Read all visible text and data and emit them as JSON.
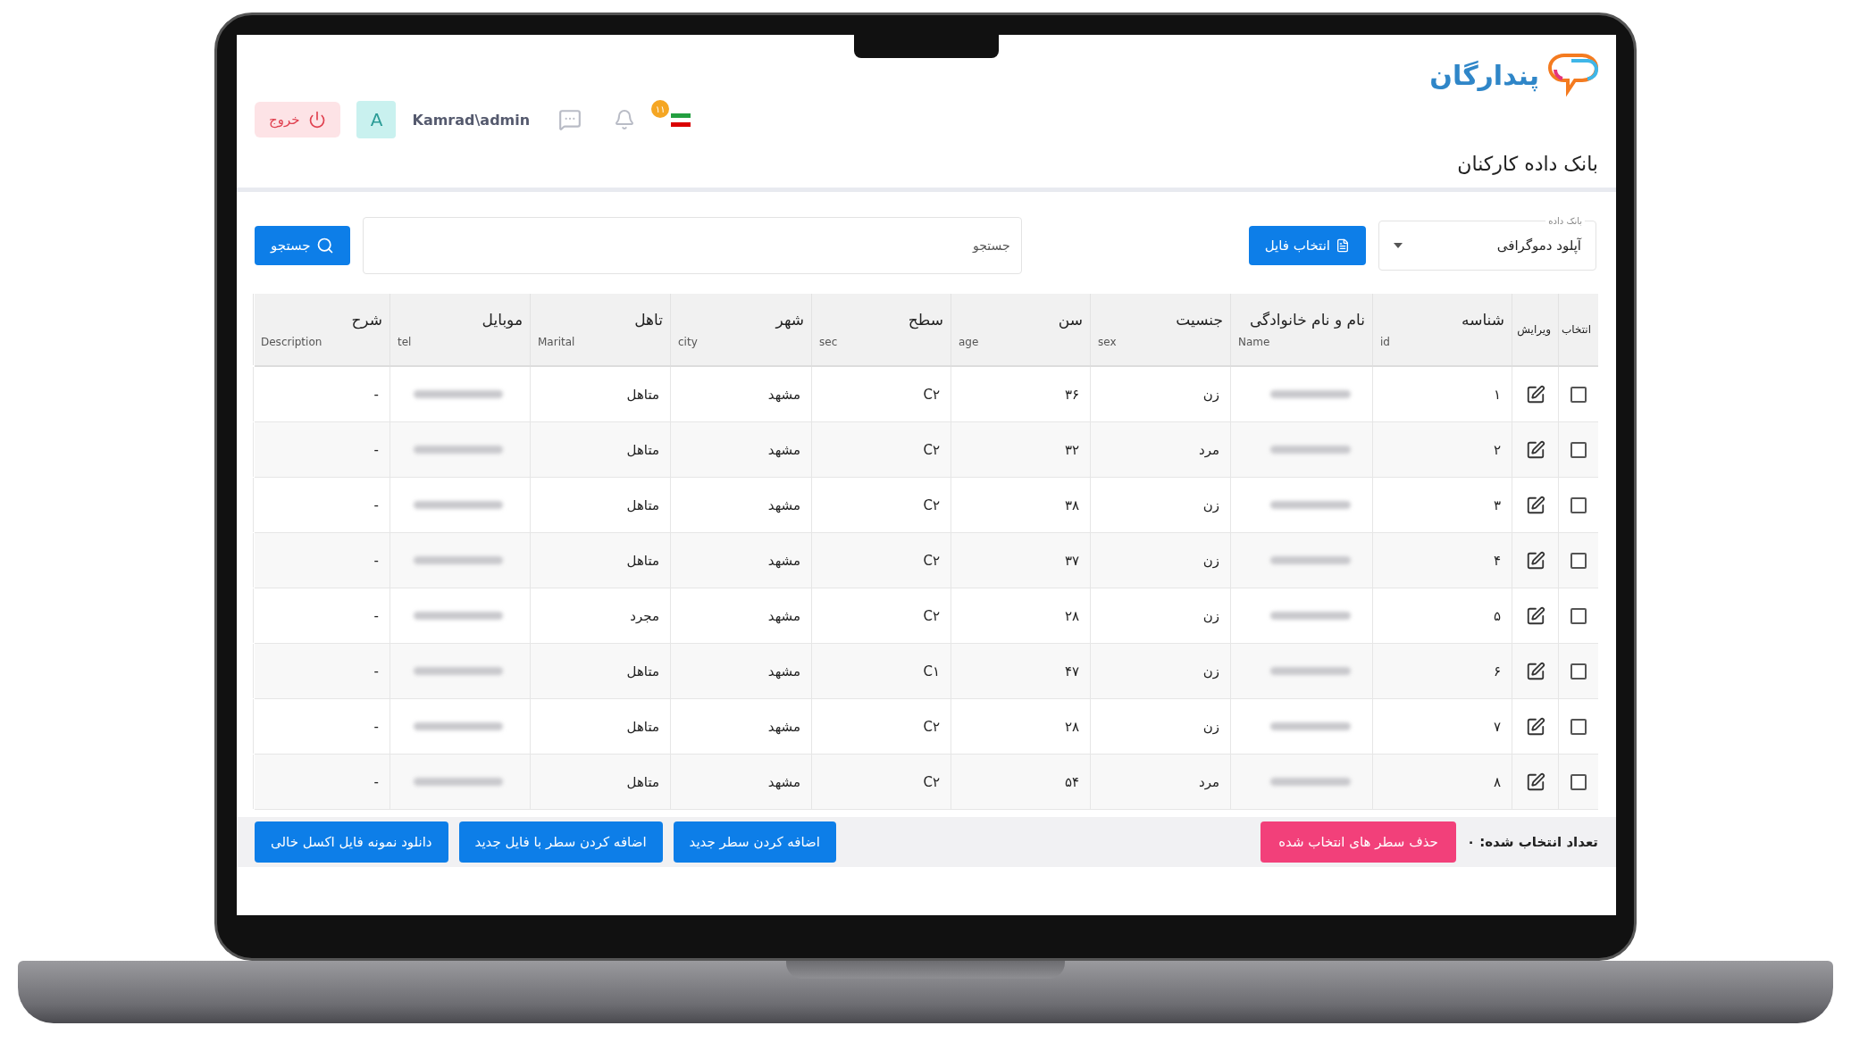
{
  "logo": {
    "text": "پندارگان"
  },
  "header": {
    "logout": "خروج",
    "avatar": "A",
    "username": "Kamrad\\admin",
    "notification_count": "۱۱"
  },
  "page_title": "بانک داده کارکنان",
  "toolbar": {
    "dataset_select": {
      "label": "بانک داده",
      "value": "آپلود دموگرافی"
    },
    "file_button": "انتخاب فایل",
    "search": {
      "placeholder": "جستجو"
    },
    "search_button": "جستجو"
  },
  "table": {
    "columns": [
      {
        "title": "انتخاب"
      },
      {
        "title": "ویرایش"
      },
      {
        "title": "شناسه",
        "subtitle": "id"
      },
      {
        "title": "نام و نام خانوادگی",
        "subtitle": "Name"
      },
      {
        "title": "جنسیت",
        "subtitle": "sex"
      },
      {
        "title": "سن",
        "subtitle": "age"
      },
      {
        "title": "سطح",
        "subtitle": "sec"
      },
      {
        "title": "شهر",
        "subtitle": "city"
      },
      {
        "title": "تاهل",
        "subtitle": "Marital"
      },
      {
        "title": "موبایل",
        "subtitle": "tel"
      },
      {
        "title": "شرح",
        "subtitle": "Description"
      }
    ],
    "rows": [
      {
        "checked": false,
        "id": "۱",
        "sex": "زن",
        "age": "۳۶",
        "sec": "C۲",
        "city": "مشهد",
        "marital": "متاهل",
        "description": "-"
      },
      {
        "checked": false,
        "id": "۲",
        "sex": "مرد",
        "age": "۳۲",
        "sec": "C۲",
        "city": "مشهد",
        "marital": "متاهل",
        "description": "-"
      },
      {
        "checked": false,
        "id": "۳",
        "sex": "زن",
        "age": "۳۸",
        "sec": "C۲",
        "city": "مشهد",
        "marital": "متاهل",
        "description": "-"
      },
      {
        "checked": false,
        "id": "۴",
        "sex": "زن",
        "age": "۳۷",
        "sec": "C۲",
        "city": "مشهد",
        "marital": "متاهل",
        "description": "-"
      },
      {
        "checked": false,
        "id": "۵",
        "sex": "زن",
        "age": "۲۸",
        "sec": "C۲",
        "city": "مشهد",
        "marital": "مجرد",
        "description": "-"
      },
      {
        "checked": false,
        "id": "۶",
        "sex": "زن",
        "age": "۴۷",
        "sec": "C۱",
        "city": "مشهد",
        "marital": "متاهل",
        "description": "-"
      },
      {
        "checked": false,
        "id": "۷",
        "sex": "زن",
        "age": "۲۸",
        "sec": "C۲",
        "city": "مشهد",
        "marital": "متاهل",
        "description": "-"
      },
      {
        "checked": false,
        "id": "۸",
        "sex": "مرد",
        "age": "۵۴",
        "sec": "C۲",
        "city": "مشهد",
        "marital": "متاهل",
        "description": "-"
      }
    ]
  },
  "footer": {
    "selected_count": "تعداد انتخاب شده: ۰",
    "delete_button": "حذف سطر های انتخاب شده",
    "buttons": [
      "اضافه کردن سطر جدید",
      "اضافه کردن سطر با فایل جدید",
      "دانلود نمونه فایل اکسل خالی"
    ]
  }
}
